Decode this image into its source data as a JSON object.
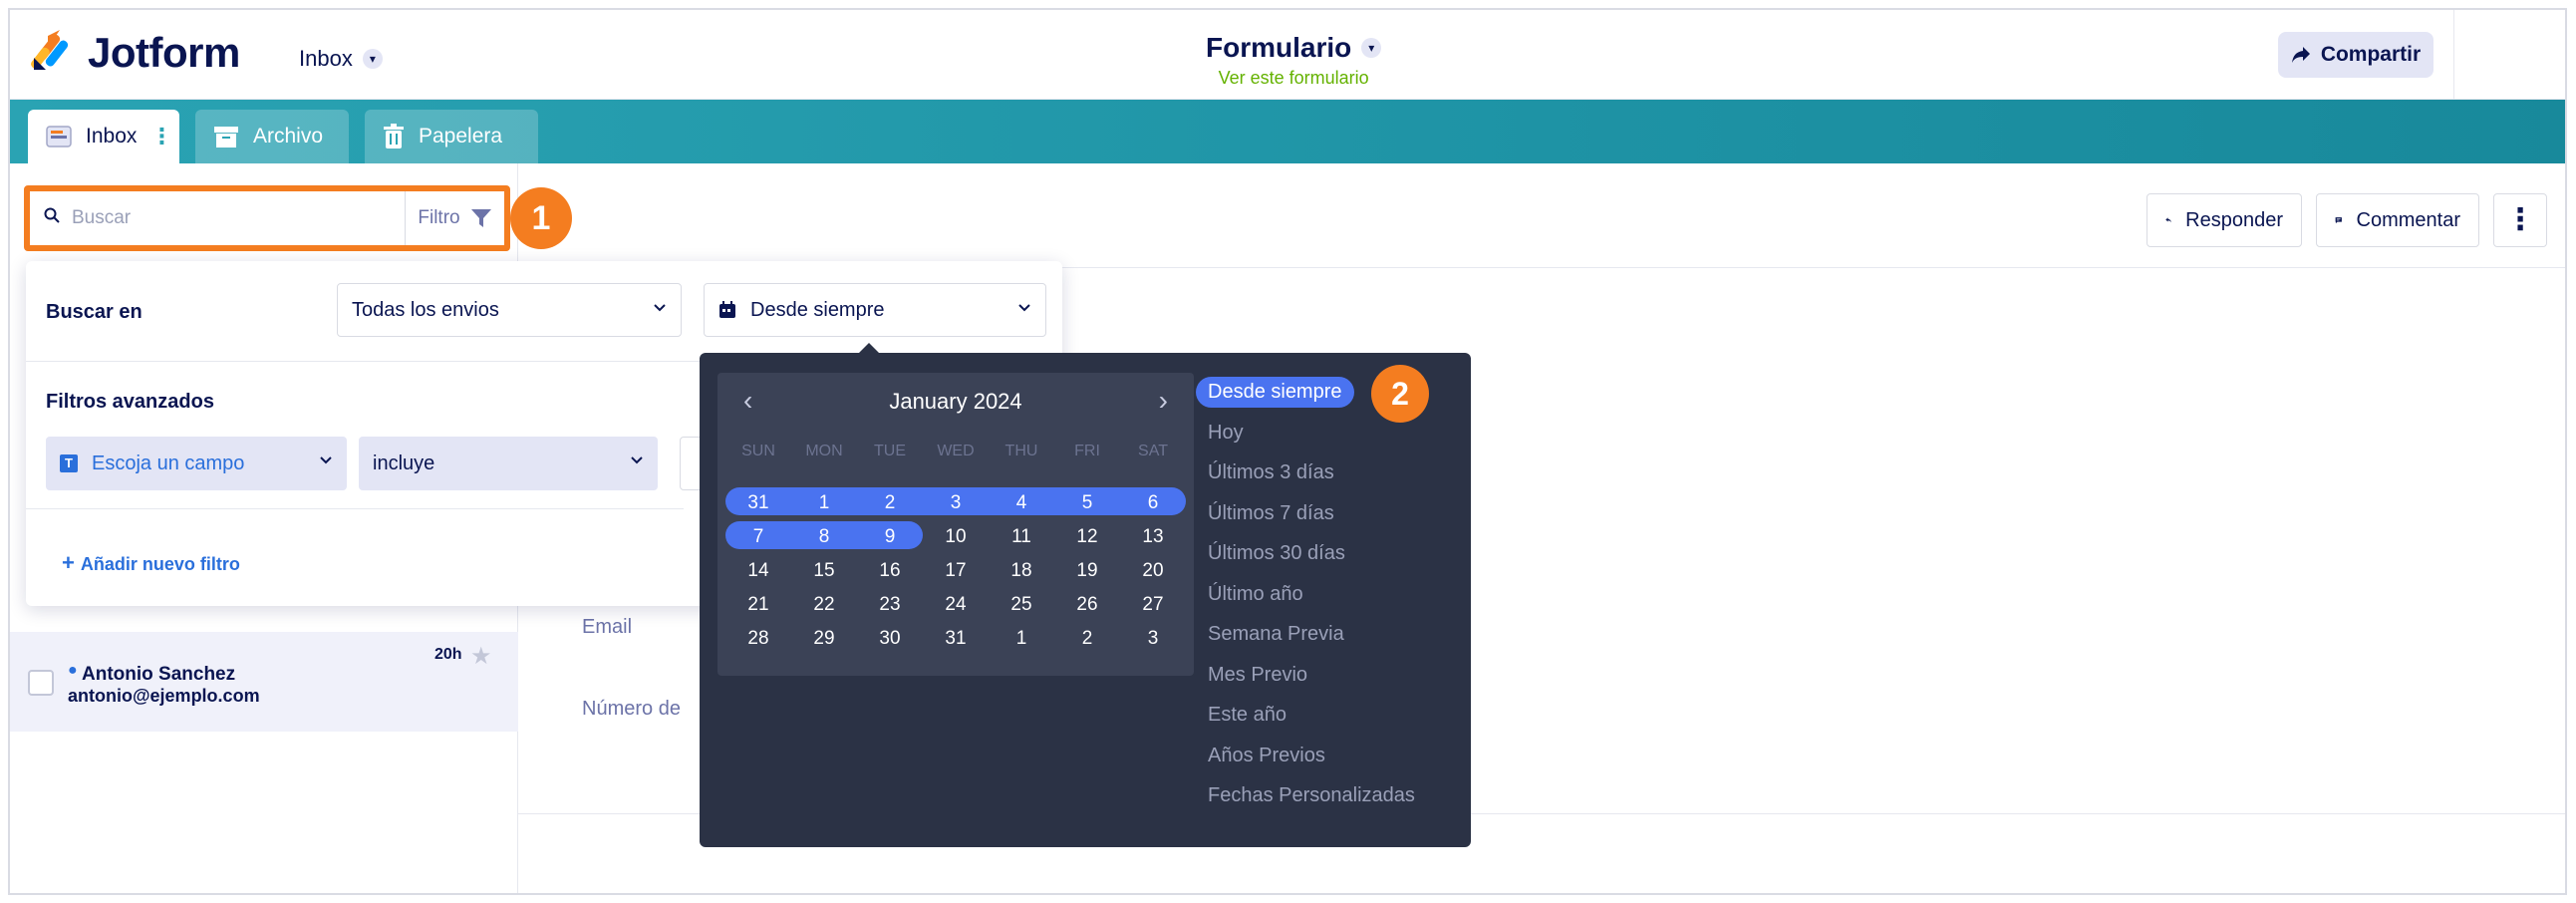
{
  "app": {
    "name": "Jotform",
    "inbox_switch": "Inbox",
    "form_title": "Formulario",
    "form_link": "Ver este formulario",
    "share": "Compartir"
  },
  "tabs": [
    {
      "label": "Inbox"
    },
    {
      "label": "Archivo"
    },
    {
      "label": "Papelera"
    }
  ],
  "search": {
    "placeholder": "Buscar",
    "filter_label": "Filtro"
  },
  "badges": {
    "one": "1",
    "two": "2"
  },
  "toolbar": {
    "reply": "Responder",
    "comment": "Commentar"
  },
  "filter_panel": {
    "search_in_label": "Buscar en",
    "search_in_value": "Todas los envios",
    "date_value": "Desde siempre",
    "advanced_label": "Filtros avanzados",
    "field_select": "Escoja un campo",
    "condition_select": "incluye",
    "add_filter": "Añadir nuevo filtro"
  },
  "calendar": {
    "month": "January 2024",
    "weekdays": [
      "SUN",
      "MON",
      "TUE",
      "WED",
      "THU",
      "FRI",
      "SAT"
    ],
    "weeks": [
      [
        "31",
        "1",
        "2",
        "3",
        "4",
        "5",
        "6"
      ],
      [
        "7",
        "8",
        "9",
        "10",
        "11",
        "12",
        "13"
      ],
      [
        "14",
        "15",
        "16",
        "17",
        "18",
        "19",
        "20"
      ],
      [
        "21",
        "22",
        "23",
        "24",
        "25",
        "26",
        "27"
      ],
      [
        "28",
        "29",
        "30",
        "31",
        "1",
        "2",
        "3"
      ]
    ],
    "selected_range": {
      "from": "Dec 31",
      "to": "Jan 9"
    }
  },
  "presets": [
    "Desde siempre",
    "Hoy",
    "Últimos 3 días",
    "Últimos 7 días",
    "Últimos 30 días",
    "Último año",
    "Semana Previa",
    "Mes Previo",
    "Este año",
    "Años Previos",
    "Fechas Personalizadas"
  ],
  "submission": {
    "name": "Antonio Sanchez",
    "email": "antonio@ejemplo.com",
    "time": "20h"
  },
  "fields": {
    "email": "Email",
    "number": "Número de"
  },
  "colors": {
    "brand_orange": "#f47d20",
    "navy": "#0a1551",
    "teal": "#1e93a5",
    "range_blue": "#4a73f0",
    "picker_bg": "#2b3245"
  }
}
